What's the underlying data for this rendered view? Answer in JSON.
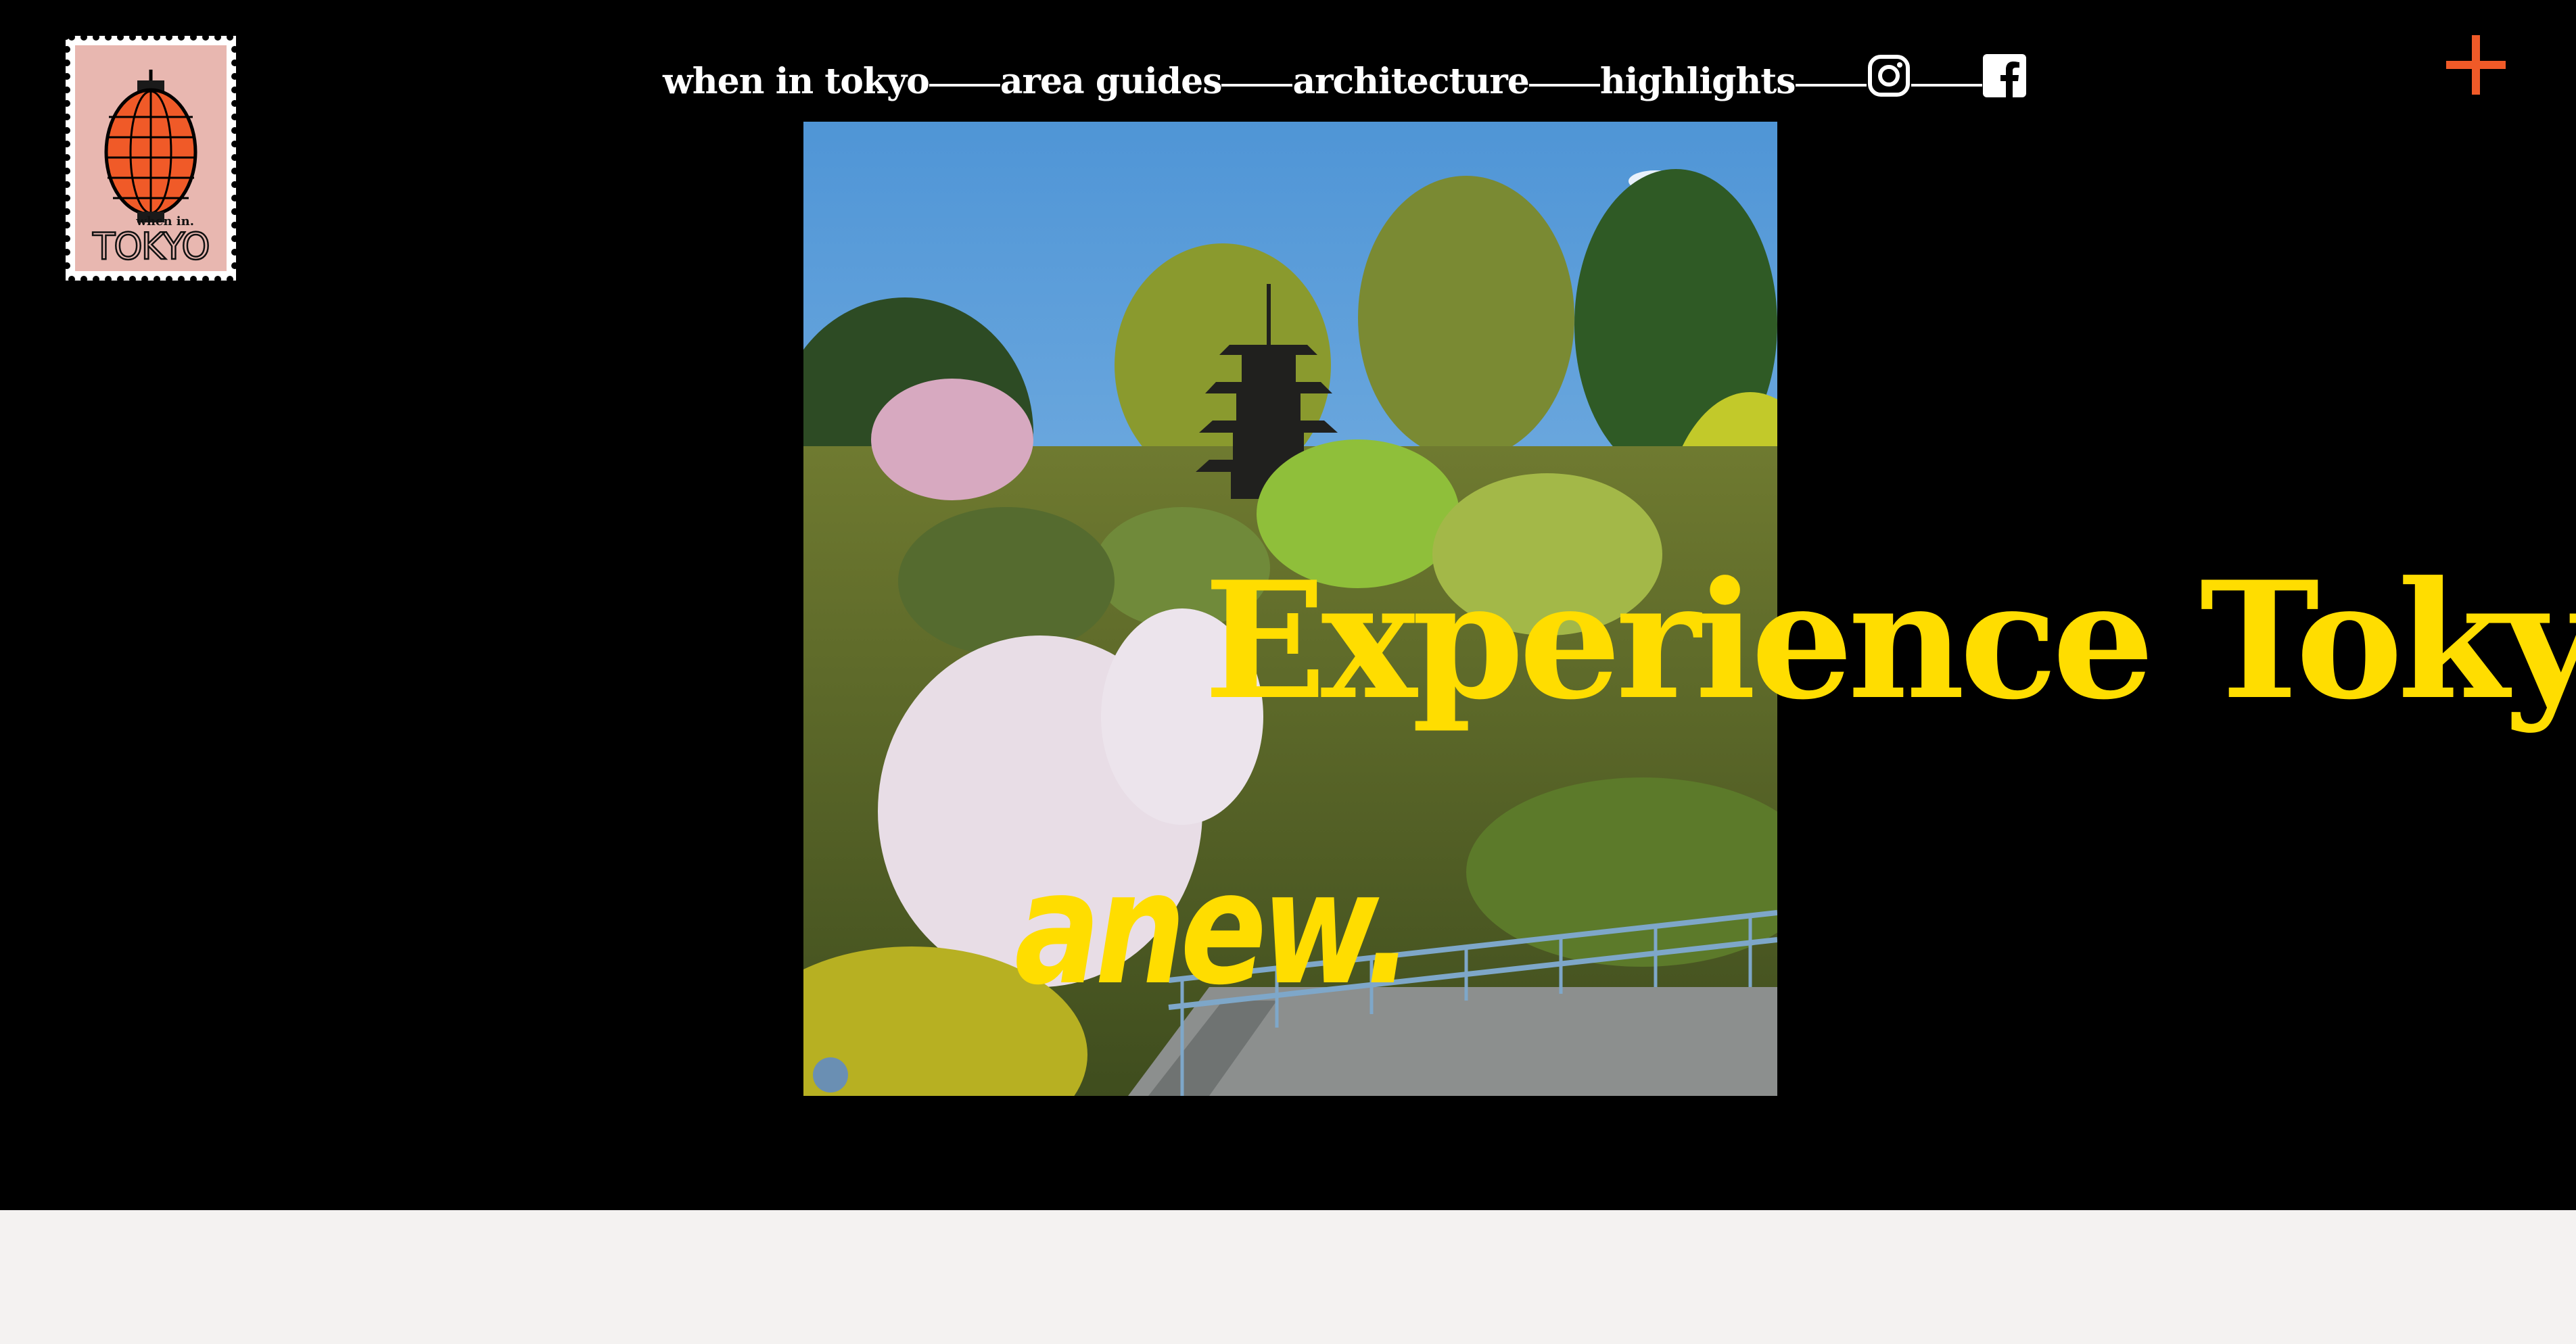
{
  "logo": {
    "small_text": "when in.",
    "big_text": "TOKYO"
  },
  "nav": {
    "items": [
      {
        "label": "when in tokyo"
      },
      {
        "label": "area guides"
      },
      {
        "label": "architecture"
      },
      {
        "label": "highlights"
      }
    ],
    "social": [
      {
        "icon": "instagram-icon"
      },
      {
        "icon": "facebook-icon"
      }
    ]
  },
  "menu_button": {
    "icon": "plus-icon"
  },
  "hero": {
    "headline_line1": "Experience Tokyo",
    "headline_line2": "anew."
  },
  "colors": {
    "background": "#000000",
    "accent_yellow": "#ffdd00",
    "accent_orange": "#f05a28",
    "stamp_pink": "#e8b7b0",
    "lower_section": "#f4f2f1"
  }
}
